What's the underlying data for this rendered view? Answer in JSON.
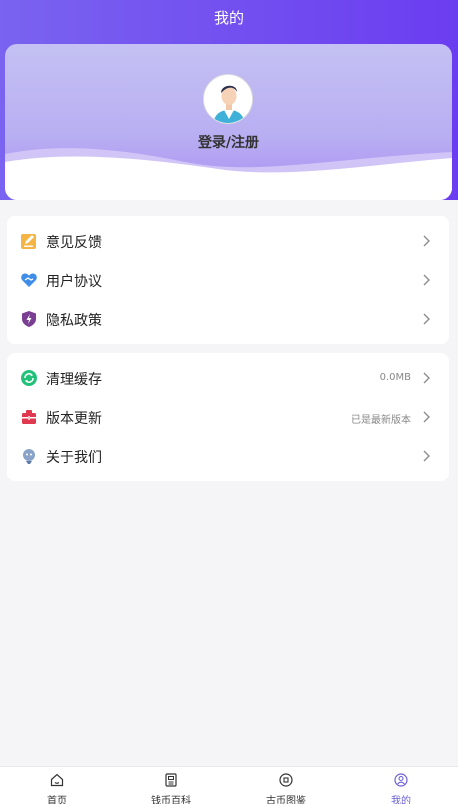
{
  "header": {
    "title": "我的"
  },
  "profile": {
    "login_label": "登录/注册"
  },
  "menu_group_1": [
    {
      "label": "意见反馈",
      "icon": "feedback-icon"
    },
    {
      "label": "用户协议",
      "icon": "agreement-icon"
    },
    {
      "label": "隐私政策",
      "icon": "privacy-icon"
    }
  ],
  "menu_group_2": [
    {
      "label": "清理缓存",
      "value": "0.0MB",
      "icon": "clear-cache-icon"
    },
    {
      "label": "版本更新",
      "value": "已是最新版本",
      "icon": "update-icon"
    },
    {
      "label": "关于我们",
      "icon": "about-icon"
    }
  ],
  "tabs": [
    {
      "label": "首页",
      "icon": "home-icon"
    },
    {
      "label": "钱币百科",
      "icon": "encyclopedia-icon"
    },
    {
      "label": "古币图鉴",
      "icon": "coin-catalog-icon"
    },
    {
      "label": "我的",
      "icon": "profile-icon",
      "active": true
    }
  ],
  "colors": {
    "accent": "#6b5fd8",
    "header_start": "#7a63f0",
    "header_end": "#6b3df0"
  }
}
